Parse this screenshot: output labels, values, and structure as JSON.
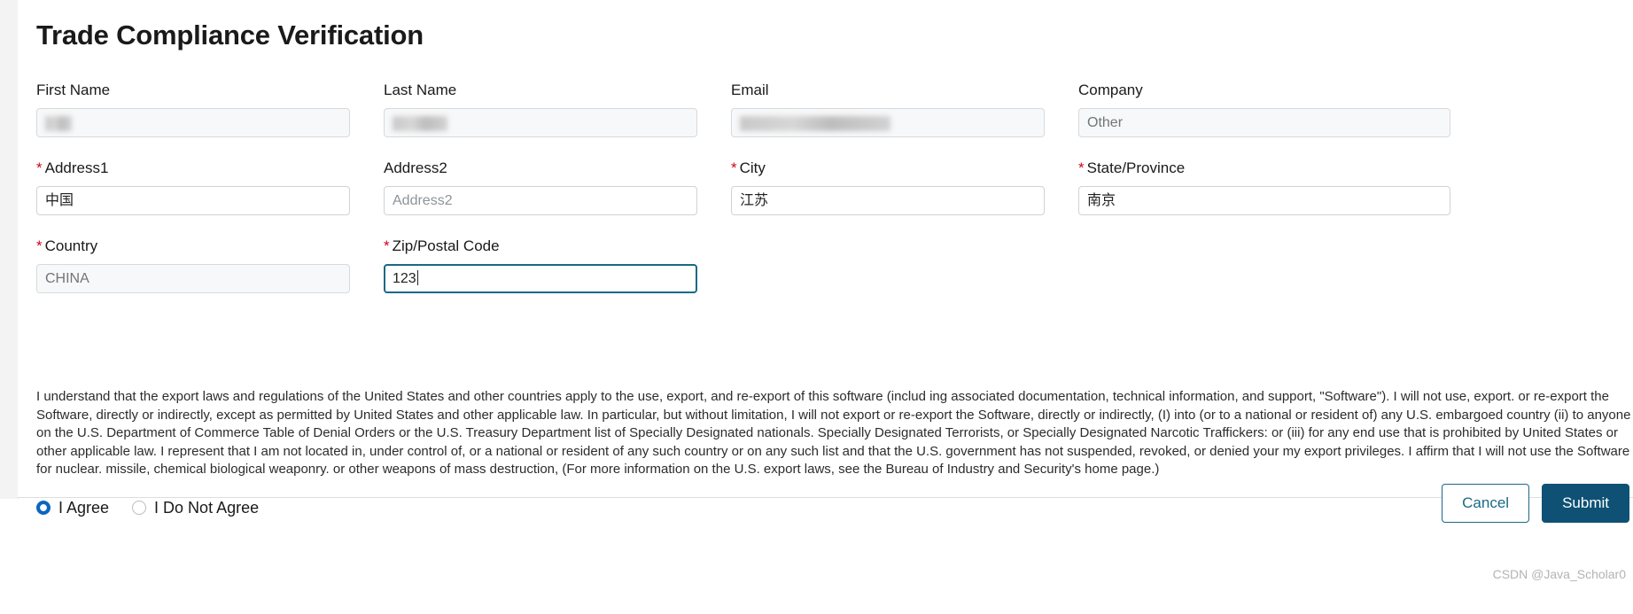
{
  "page": {
    "title": "Trade Compliance Verification",
    "watermark": "CSDN @Java_Scholar0"
  },
  "form": {
    "rows": [
      {
        "fields": [
          {
            "label": "First Name",
            "required": false,
            "value": "",
            "placeholder": "",
            "state": "disabled-blurred",
            "blur": "small"
          },
          {
            "label": "Last Name",
            "required": false,
            "value": "",
            "placeholder": "",
            "state": "disabled-blurred",
            "blur": "medium"
          },
          {
            "label": "Email",
            "required": false,
            "value": "",
            "placeholder": "",
            "state": "disabled-blurred",
            "blur": "large"
          },
          {
            "label": "Company",
            "required": false,
            "value": "Other",
            "placeholder": "",
            "state": "disabled"
          }
        ]
      },
      {
        "fields": [
          {
            "label": "Address1",
            "required": true,
            "value": "中国",
            "placeholder": "",
            "state": "filled"
          },
          {
            "label": "Address2",
            "required": false,
            "value": "",
            "placeholder": "Address2",
            "state": "placeholder"
          },
          {
            "label": "City",
            "required": true,
            "value": "江苏",
            "placeholder": "",
            "state": "filled"
          },
          {
            "label": "State/Province",
            "required": true,
            "value": "南京",
            "placeholder": "",
            "state": "filled"
          }
        ]
      },
      {
        "fields": [
          {
            "label": "Country",
            "required": true,
            "value": "CHINA",
            "placeholder": "",
            "state": "disabled"
          },
          {
            "label": "Zip/Postal Code",
            "required": true,
            "value": "123",
            "placeholder": "",
            "state": "focused"
          }
        ]
      }
    ]
  },
  "legal": {
    "text": "I understand that the export laws and regulations of the United States and other countries apply to the use, export, and re-export of this software (includ ing associated documentation, technical information, and support, \"Software\"). I will not use, export. or re-export the Software, directly or indirectly, except as permitted by United States and other applicable law. In particular, but without limitation, I will not export or re-export the Software, directly or indirectly, (I) into (or to a national or resident of) any U.S. embargoed country (ii) to anyone on the U.S. Department of Commerce Table of Denial Orders or the U.S. Treasury Department list of Specially Designated nationals. Specially Designated Terrorists, or Specially Designated Narcotic Traffickers: or (iii) for any end use that is prohibited by United States or other applicable law. I represent that I am not located in, under control of, or a national or resident of any such country or on any such list and that the U.S. government has not suspended, revoked, or denied your my export privileges. I affirm that I will not use the Software for nuclear. missile, chemical biological weaponry. or other weapons of mass destruction, (For more information on the U.S. export laws, see the Bureau of Industry and Security's home page.)"
  },
  "consent": {
    "options": [
      {
        "label": "I Agree",
        "selected": true
      },
      {
        "label": "I Do Not Agree",
        "selected": false
      }
    ]
  },
  "actions": {
    "cancel_label": "Cancel",
    "submit_label": "Submit"
  },
  "colors": {
    "required_star": "#d0021b",
    "focus_border": "#1a6985",
    "submit_bg": "#0e5174",
    "cancel_border": "#1a6985",
    "radio_selected": "#0a66c2"
  }
}
